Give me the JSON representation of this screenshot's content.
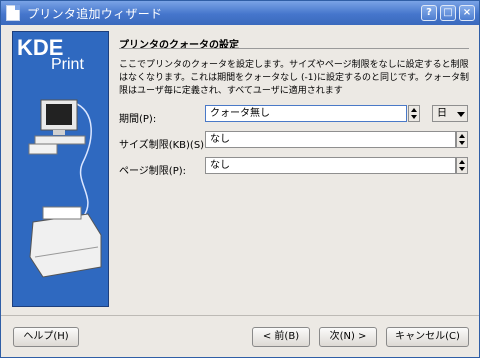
{
  "window": {
    "title": "プリンタ追加ウィザード"
  },
  "titlebar": {
    "help": "?",
    "maximize": "□",
    "close": "×"
  },
  "sidebar": {
    "logo_kde": "KDE",
    "logo_print": "Print"
  },
  "page": {
    "heading": "プリンタのクォータの設定",
    "description": "ここでプリンタのクォータを設定します。サイズやページ制限をなしに設定すると制限はなくなります。これは期間をクォータなし (-1)に設定するのと同じです。クォータ制限はユーザ毎に定義され、すべてユーザに適用されます"
  },
  "form": {
    "period_label": "期間(P):",
    "period_value": "クォータ無し",
    "unit_value": "日",
    "size_label": "サイズ制限(KB)(S):",
    "size_value": "なし",
    "pages_label": "ページ制限(P):",
    "pages_value": "なし"
  },
  "buttons": {
    "help": "ヘルプ(H)",
    "back": "< 前(B)",
    "next": "次(N) >",
    "cancel": "キャンセル(C)"
  }
}
